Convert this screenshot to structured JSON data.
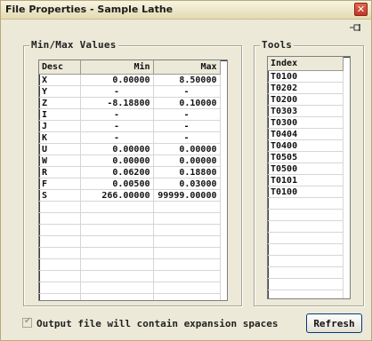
{
  "window": {
    "title": "File Properties - Sample Lathe",
    "close_glyph": "✕"
  },
  "minmax": {
    "label": "Min/Max Values",
    "columns": [
      "Desc",
      "Min",
      "Max"
    ],
    "rows": [
      [
        "X",
        "0.00000",
        "8.50000"
      ],
      [
        "Y",
        "-",
        "-"
      ],
      [
        "Z",
        "-8.18800",
        "0.10000"
      ],
      [
        "I",
        "-",
        "-"
      ],
      [
        "J",
        "-",
        "-"
      ],
      [
        "K",
        "-",
        "-"
      ],
      [
        "U",
        "0.00000",
        "0.00000"
      ],
      [
        "W",
        "0.00000",
        "0.00000"
      ],
      [
        "R",
        "0.06200",
        "0.18800"
      ],
      [
        "F",
        "0.00500",
        "0.03000"
      ],
      [
        "S",
        "266.00000",
        "99999.00000"
      ]
    ]
  },
  "tools": {
    "label": "Tools",
    "column": "Index",
    "items": [
      "T0100",
      "T0202",
      "T0200",
      "T0303",
      "T0300",
      "T0404",
      "T0400",
      "T0505",
      "T0500",
      "T0101",
      "T0100"
    ]
  },
  "footer": {
    "checkbox_label": "Output file will contain expansion spaces",
    "checkbox_checked": true,
    "refresh_label": "Refresh"
  }
}
